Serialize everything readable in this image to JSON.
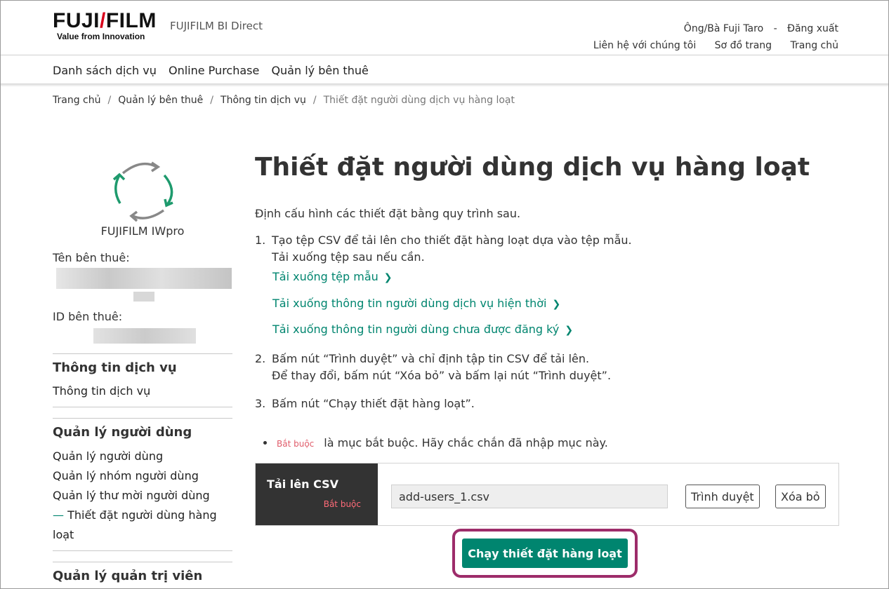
{
  "header": {
    "brand": {
      "word": "FUJIFILM",
      "tagline": "Value from Innovation"
    },
    "site_name": "FUJIFILM BI Direct",
    "user_name": "Ông/Bà Fuji Taro",
    "user_sep": "-",
    "logout": "Đăng xuất",
    "links": [
      "Liên hệ với chúng tôi",
      "Sơ đồ trang",
      "Trang chủ"
    ]
  },
  "global_nav": [
    "Danh sách dịch vụ",
    "Online Purchase",
    "Quản lý bên thuê"
  ],
  "breadcrumb": {
    "items": [
      "Trang chủ",
      "Quản lý bên thuê",
      "Thông tin dịch vụ"
    ],
    "separator": "/",
    "current": "Thiết đặt người dùng dịch vụ hàng loạt"
  },
  "sidebar": {
    "service_name": "FUJIFILM IWpro",
    "tenant_name_label": "Tên bên thuê:",
    "tenant_id_label": "ID bên thuê:",
    "sections": [
      {
        "heading": "Thông tin dịch vụ",
        "items": [
          "Thông tin dịch vụ"
        ]
      },
      {
        "heading": "Quản lý người dùng",
        "items": [
          "Quản lý người dùng",
          "Quản lý nhóm người dùng",
          "Quản lý thư mời người dùng"
        ],
        "active_item_prefix": "—",
        "active_item_line1": "Thiết đặt người dùng hàng",
        "active_item_line2": "loạt"
      },
      {
        "heading": "Quản lý quản trị viên",
        "items": []
      }
    ]
  },
  "main": {
    "title": "Thiết đặt người dùng dịch vụ hàng loạt",
    "intro": "Định cấu hình các thiết đặt bằng quy trình sau.",
    "steps": [
      {
        "num": "1.",
        "line1": "Tạo tệp CSV để tải lên cho thiết đặt hàng loạt dựa vào tệp mẫu.",
        "line2": "Tải xuống tệp sau nếu cần."
      },
      {
        "num": "2.",
        "line1": "Bấm nút “Trình duyệt” và chỉ định tập tin CSV để tải lên.",
        "line2": "Để thay đổi, bấm nút “Xóa bỏ” và bấm lại nút “Trình duyệt”."
      },
      {
        "num": "3.",
        "line1": "Bấm nút “Chạy thiết đặt hàng loạt”."
      }
    ],
    "download_links": [
      "Tải xuống tệp mẫu",
      "Tải xuống thông tin người dùng dịch vụ hiện thời",
      "Tải xuống thông tin người dùng chưa được đăng ký"
    ],
    "required_badge": "Bắt buộc",
    "required_note": "là mục bắt buộc. Hãy chắc chắn đã nhập mục này.",
    "upload": {
      "label": "Tải lên CSV",
      "required": "Bắt buộc",
      "file_value": "add-users_1.csv",
      "browse_label": "Trình duyệt",
      "clear_label": "Xóa bỏ"
    },
    "run_button": "Chạy thiết đặt hàng loạt"
  },
  "colors": {
    "accent": "#00856f",
    "required": "#e05c6a",
    "highlight": "#9d2c6a",
    "dark_header": "#333333"
  },
  "icons": {
    "service_logo": "rotate-arrows-icon",
    "link_chevron": "chevron-right-icon"
  }
}
